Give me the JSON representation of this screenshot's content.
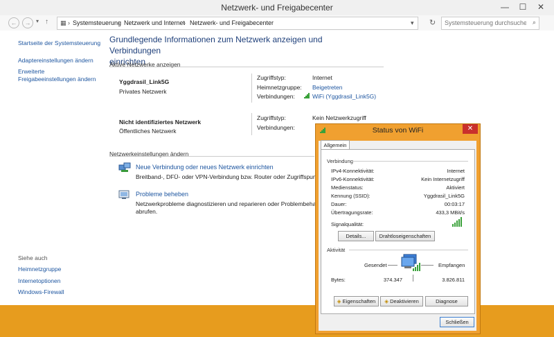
{
  "window": {
    "title": "Netzwerk- und Freigabecenter",
    "controls": {
      "minimize": "—",
      "maximize": "☐",
      "close": "✕"
    }
  },
  "address": {
    "crumbs": [
      "Systemsteuerung",
      "Netzwerk und Internet",
      "Netzwerk- und Freigabecenter"
    ],
    "search_placeholder": "Systemsteuerung durchsuchen"
  },
  "sidebar": {
    "items": [
      "Startseite der Systemsteuerung",
      "Adaptereinstellungen ändern",
      "Erweiterte",
      "Freigabeeinstellungen ändern"
    ],
    "see_also_label": "Siehe auch",
    "see_also": [
      "Heimnetzgruppe",
      "Internetoptionen",
      "Windows-Firewall"
    ]
  },
  "main": {
    "heading_line1": "Grundlegende Informationen zum Netzwerk anzeigen und Verbindungen",
    "heading_line2": "einrichten",
    "active_label": "Aktive Netzwerke anzeigen",
    "networks": [
      {
        "name": "Yggdrasil_Link5G",
        "type": "Privates Netzwerk",
        "access_label": "Zugriffstyp:",
        "access": "Internet",
        "homegroup_label": "Heimnetzgruppe:",
        "homegroup": "Beigetreten",
        "conn_label": "Verbindungen:",
        "conn": "WiFi (Yggdrasil_Link5G)"
      },
      {
        "name": "Nicht identifiziertes Netzwerk",
        "type": "Öffentliches Netzwerk",
        "access_label": "Zugriffstyp:",
        "access": "Kein Netzwerkzugriff",
        "conn_label": "Verbindungen:"
      }
    ],
    "change_label": "Netzwerkeinstellungen ändern",
    "tasks": [
      {
        "title": "Neue Verbindung oder neues Netzwerk einrichten",
        "desc": "Breitband-, DFÜ- oder VPN-Verbindung bzw. Router oder Zugriffspunkt"
      },
      {
        "title": "Probleme beheben",
        "desc1": "Netzwerkprobleme diagnostizieren und reparieren oder Problembehan",
        "desc2": "abrufen."
      }
    ]
  },
  "dialog": {
    "title": "Status von WiFi",
    "close": "✕",
    "tab": "Allgemein",
    "conn_group": "Verbindung",
    "rows": [
      {
        "label": "IPv4-Konnektivität:",
        "value": "Internet"
      },
      {
        "label": "IPv6-Konnektivität:",
        "value": "Kein Internetzugriff"
      },
      {
        "label": "Medienstatus:",
        "value": "Aktiviert"
      },
      {
        "label": "Kennung (SSID):",
        "value": "Yggdrasil_Link5G"
      },
      {
        "label": "Dauer:",
        "value": "00:03:17"
      },
      {
        "label": "Übertragungsrate:",
        "value": "433,3 MBit/s"
      }
    ],
    "signal_label": "Signalqualität:",
    "signal_bars": 5,
    "details_btn": "Details...",
    "wireless_btn": "Drahtloseigenschaften",
    "activity_group": "Aktivität",
    "sent_label": "Gesendet",
    "recv_label": "Empfangen",
    "bytes_label": "Bytes:",
    "bytes_sent": "374.347",
    "bytes_recv": "3.826.811",
    "props_btn": "Eigenschaften",
    "disable_btn": "Deaktivieren",
    "diag_btn": "Diagnose",
    "close_btn": "Schließen"
  }
}
